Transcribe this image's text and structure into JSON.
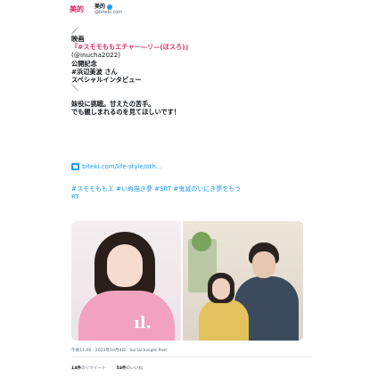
{
  "account": {
    "avatar_text": "美的",
    "display_name": "美的",
    "handle": "@biteki.com"
  },
  "tweet": {
    "lines": [
      "／",
      "映画",
      "『#スモモももエチャー—リ—(ほスろ)』",
      "(@inucha2022)",
      "公開記念",
      "#浜辺美波 さん",
      "スペシャルインタビュー",
      "＼",
      "",
      "妹役に挑戦。甘えたの苦手。",
      "でも親しまれるのを見てほしいです！"
    ],
    "link_text": "biteki.com/life-style/oth…",
    "hashtags": "#スモモももエ #いぬ描き夢 #SRT #鬼滅のいにき夢をもう\nRT"
  },
  "media": {
    "left_mark": "ıl."
  },
  "meta": {
    "time_date": "午後11:00 · 2022年10月4日 · Social Insight Post"
  },
  "stats": {
    "retweets_count": "14件",
    "retweets_label": "のリツイート",
    "likes_count": "53件",
    "likes_label": "のいいね"
  }
}
